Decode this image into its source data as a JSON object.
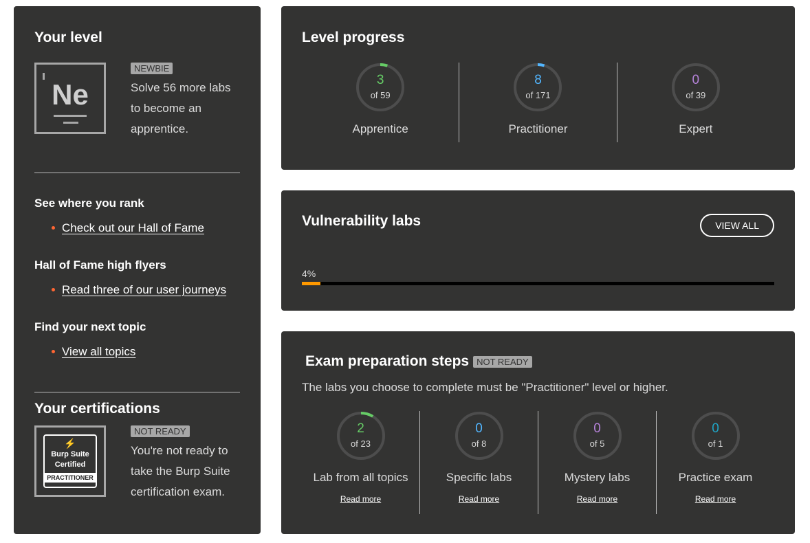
{
  "level": {
    "title": "Your level",
    "badge": "NEWBIE",
    "element_symbol": "Ne",
    "description": "Solve 56 more labs to become an apprentice."
  },
  "links": {
    "rank_heading": "See where you rank",
    "rank_link": "Check out our Hall of Fame",
    "flyers_heading": "Hall of Fame high flyers",
    "flyers_link": "Read three of our user journeys",
    "topic_heading": "Find your next topic",
    "topic_link": "View all topics"
  },
  "certifications": {
    "title": "Your certifications",
    "badge": "NOT READY",
    "description": "You're not ready to take the Burp Suite certification exam.",
    "logo_text": [
      "Burp Suite",
      "Certified",
      "PRACTITIONER"
    ]
  },
  "level_progress": {
    "title": "Level progress",
    "items": [
      {
        "value": "3",
        "of": "of 59",
        "label": "Apprentice",
        "color": "#66cc66",
        "fraction": 0.051
      },
      {
        "value": "8",
        "of": "of 171",
        "label": "Practitioner",
        "color": "#52b6ff",
        "fraction": 0.047
      },
      {
        "value": "0",
        "of": "of 39",
        "label": "Expert",
        "color": "#b583d9",
        "fraction": 0
      }
    ]
  },
  "vuln_labs": {
    "title": "Vulnerability labs",
    "button": "VIEW ALL",
    "progress_label": "4%",
    "progress": 0.04,
    "bar_color": "#ff9900"
  },
  "exam": {
    "title": "Exam preparation steps",
    "badge": "NOT READY",
    "subtitle": "The labs you choose to complete must be \"Practitioner\" level or higher.",
    "items": [
      {
        "value": "2",
        "of": "of 23",
        "label": "Lab from all topics",
        "link": "Read more",
        "color": "#66cc66",
        "fraction": 0.087
      },
      {
        "value": "0",
        "of": "of 8",
        "label": "Specific labs",
        "link": "Read more",
        "color": "#52b6ff",
        "fraction": 0
      },
      {
        "value": "0",
        "of": "of 5",
        "label": "Mystery labs",
        "link": "Read more",
        "color": "#b583d9",
        "fraction": 0
      },
      {
        "value": "0",
        "of": "of 1",
        "label": "Practice exam",
        "link": "Read more",
        "color": "#1fa5c6",
        "fraction": 0
      }
    ]
  }
}
